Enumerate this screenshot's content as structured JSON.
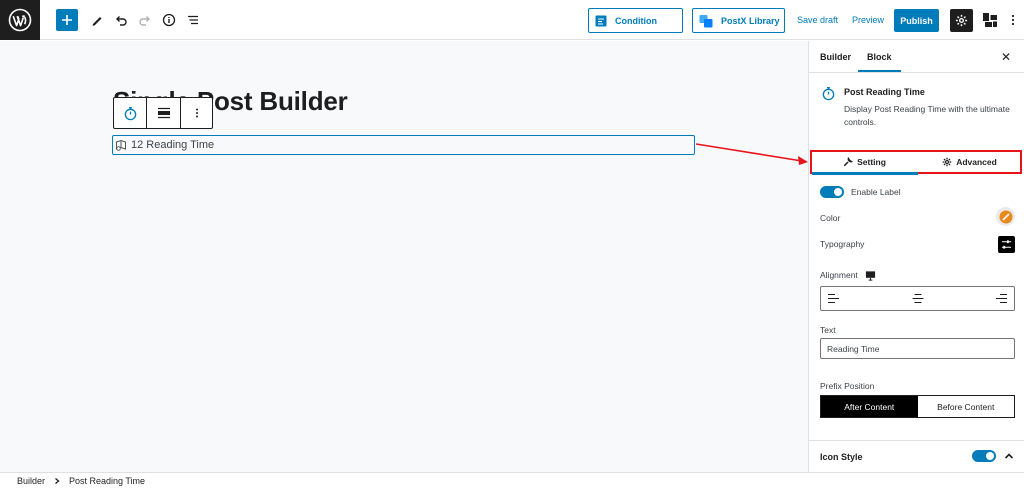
{
  "toolbar": {
    "condition_label": "Condition",
    "postx_library_label": "PostX Library",
    "save_draft_label": "Save draft",
    "preview_label": "Preview",
    "publish_label": "Publish",
    "accent_color": "#007cba"
  },
  "canvas": {
    "post_title": "Single Post Builder",
    "reading_block_text": "12 Reading Time"
  },
  "sidebar": {
    "tabs": [
      {
        "label": "Builder",
        "active": false
      },
      {
        "label": "Block",
        "active": true
      }
    ],
    "block_name": "Post Reading Time",
    "block_description": "Display Post Reading Time with the ultimate controls.",
    "sub_tabs": [
      {
        "label": "Setting",
        "icon": "wrench-icon",
        "active": true
      },
      {
        "label": "Advanced",
        "icon": "gear-icon",
        "active": false
      }
    ],
    "enable_label": "Enable Label",
    "color_label": "Color",
    "typography_label": "Typography",
    "alignment_label": "Alignment",
    "text_label": "Text",
    "text_value": "Reading Time",
    "prefix_position_label": "Prefix Position",
    "prefix_options": [
      {
        "label": "After Content",
        "selected": true
      },
      {
        "label": "Before Content",
        "selected": false
      }
    ],
    "icon_style_label": "Icon Style",
    "highlight_color": "#e8141b"
  },
  "footer": {
    "breadcrumb": [
      "Builder",
      "Post Reading Time"
    ]
  }
}
